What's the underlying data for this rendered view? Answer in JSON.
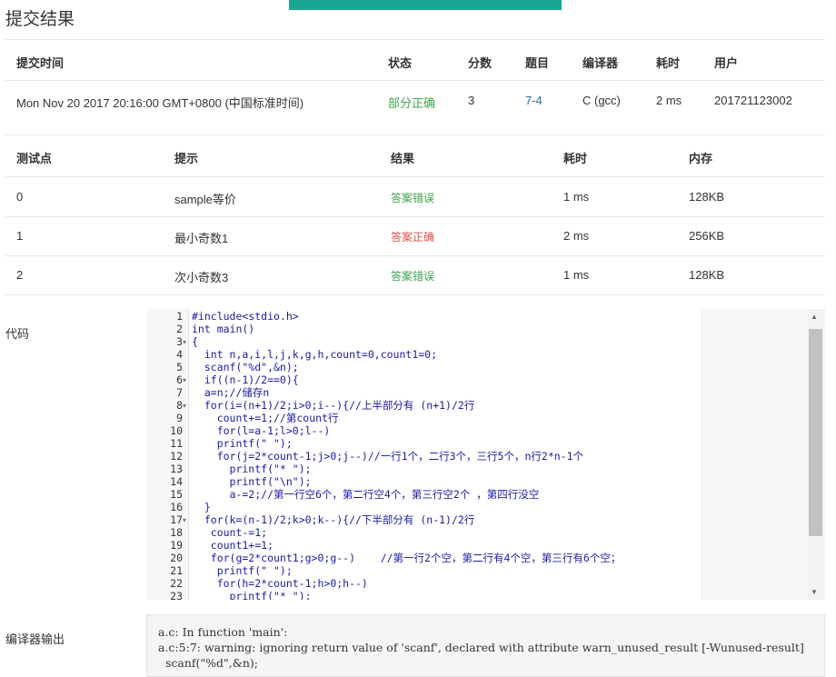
{
  "page_title": "提交结果",
  "submission_table": {
    "headers": [
      "提交时间",
      "状态",
      "分数",
      "题目",
      "编译器",
      "耗时",
      "用户"
    ],
    "row": {
      "time": "Mon Nov 20 2017 20:16:00 GMT+0800 (中国标准时间)",
      "status": "部分正确",
      "score": "3",
      "problem": "7-4",
      "compiler": "C (gcc)",
      "elapsed": "2 ms",
      "user": "201721123002"
    }
  },
  "test_table": {
    "headers": [
      "测试点",
      "提示",
      "结果",
      "耗时",
      "内存"
    ],
    "rows": [
      {
        "id": "0",
        "hint": "sample等价",
        "result": "答案错误",
        "time": "1 ms",
        "memory": "128KB"
      },
      {
        "id": "1",
        "hint": "最小奇数1",
        "result": "答案正确",
        "time": "2 ms",
        "memory": "256KB"
      },
      {
        "id": "2",
        "hint": "次小奇数3",
        "result": "答案错误",
        "time": "1 ms",
        "memory": "128KB"
      }
    ]
  },
  "code_section": {
    "label": "代码",
    "line_numbers": [
      "1",
      "2",
      "3",
      "4",
      "5",
      "6",
      "7",
      "8",
      "9",
      "10",
      "11",
      "12",
      "13",
      "14",
      "15",
      "16",
      "17",
      "18",
      "19",
      "20",
      "21",
      "22",
      "23"
    ],
    "lines": [
      "#include<stdio.h>",
      "int main()",
      "{",
      "  int n,a,i,l,j,k,g,h,count=0,count1=0;",
      "  scanf(\"%d\",&n);",
      "  if((n-1)/2==0){",
      "  a=n;//储存n",
      "  for(i=(n+1)/2;i>0;i--){//上半部分有 (n+1)/2行",
      "    count+=1;//第count行",
      "    for(l=a-1;l>0;l--)",
      "    printf(\" \");",
      "    for(j=2*count-1;j>0;j--)//一行1个，二行3个，三行5个，n行2*n-1个",
      "      printf(\"* \");",
      "      printf(\"\\n\");",
      "      a-=2;//第一行空6个，第二行空4个，第三行空2个 ，第四行没空",
      "  }",
      "  for(k=(n-1)/2;k>0;k--){//下半部分有 (n-1)/2行",
      "   count-=1;",
      "   count1+=1;",
      "   for(g=2*count1;g>0;g--)    //第一行2个空，第二行有4个空，第三行有6个空；",
      "    printf(\" \");",
      "    for(h=2*count-1;h>0;h--)",
      "      printf(\"* \");"
    ],
    "fold_markers": {
      "3": "▾",
      "6": "▾",
      "8": "▾",
      "17": "▾"
    }
  },
  "compiler_output": {
    "label": "编译器输出",
    "text": "a.c: In function 'main':\na.c:5:7: warning: ignoring return value of 'scanf', declared with attribute warn_unused_result [-Wunused-result]\n  scanf(\"%d\",&n);"
  },
  "colors": {
    "accent": "#1aa692",
    "ok": "#3fa34d",
    "error": "#d9534f",
    "link": "#2a6db0"
  },
  "icons": {
    "scroll_up": "scroll-up-arrow-icon",
    "scroll_down": "scroll-down-arrow-icon",
    "fold": "fold-arrow-icon"
  }
}
